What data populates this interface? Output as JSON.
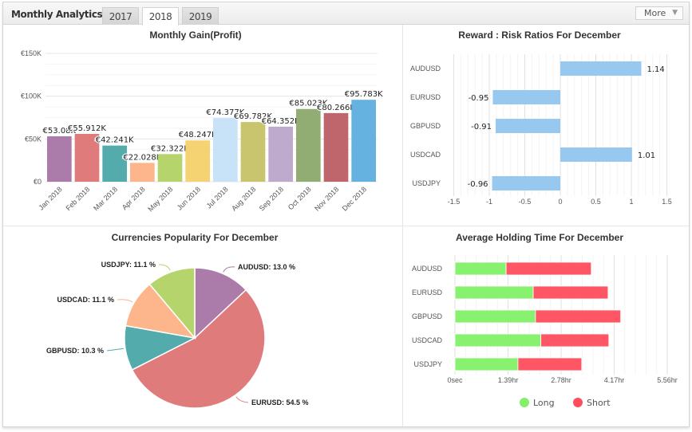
{
  "header": {
    "title": "Monthly Analytics",
    "tabs": [
      {
        "label": "2017",
        "active": false
      },
      {
        "label": "2018",
        "active": true
      },
      {
        "label": "2019",
        "active": false
      }
    ],
    "more_label": "More",
    "more_icon": "caret-down-icon"
  },
  "chart_data": [
    {
      "id": "monthly-gain",
      "type": "bar",
      "title": "Monthly Gain(Profit)",
      "xlabel": "",
      "ylabel": "",
      "categories": [
        "Jan 2018",
        "Feb 2018",
        "Mar 2018",
        "Apr 2018",
        "May 2018",
        "Jun 2018",
        "Jul 2018",
        "Aug 2018",
        "Sep 2018",
        "Oct 2018",
        "Nov 2018",
        "Dec 2018"
      ],
      "values": [
        53.08,
        55.912,
        42.241,
        22.028,
        32.322,
        48.247,
        74.377,
        69.782,
        64.352,
        85.023,
        80.266,
        95.783
      ],
      "data_labels": [
        "€53.08K",
        "€55.912K",
        "€42.241K",
        "€22.028K",
        "€32.322K",
        "€48.247K",
        "€74.377K",
        "€69.782K",
        "€64.352K",
        "€85.023K",
        "€80.266K",
        "€95.783K"
      ],
      "colors": [
        "#ab7ba9",
        "#e07b7b",
        "#54abab",
        "#fdb68c",
        "#b6d46c",
        "#f5d272",
        "#c8e2f7",
        "#c9c46e",
        "#bdaacd",
        "#92ad74",
        "#bf666d",
        "#65b1df"
      ],
      "ylim": [
        0,
        150
      ],
      "yticks": [
        0,
        50,
        100,
        150
      ],
      "ytick_labels": [
        "€0",
        "€50K",
        "€100K",
        "€150K"
      ],
      "unit": "K EUR",
      "grid": true,
      "legend": "none"
    },
    {
      "id": "reward-risk",
      "type": "bar",
      "orientation": "horizontal",
      "title": "Reward : Risk Ratios For December",
      "categories": [
        "AUDUSD",
        "EURUSD",
        "GBPUSD",
        "USDCAD",
        "USDJPY"
      ],
      "values": [
        1.14,
        -0.95,
        -0.91,
        1.01,
        -0.96
      ],
      "data_labels": [
        "1.14",
        "-0.95",
        "-0.91",
        "1.01",
        "-0.96"
      ],
      "color": "#97c8f0",
      "xlim": [
        -1.5,
        1.5
      ],
      "xticks": [
        -1.5,
        -1,
        -0.5,
        0,
        0.5,
        1,
        1.5
      ],
      "xtick_labels": [
        "-1.5",
        "-1",
        "-0.5",
        "0",
        "0.5",
        "1",
        "1.5"
      ],
      "grid": true,
      "legend": "none"
    },
    {
      "id": "currencies-popularity",
      "type": "pie",
      "title": "Currencies Popularity For December",
      "labels": [
        "AUDUSD",
        "EURUSD",
        "GBPUSD",
        "USDCAD",
        "USDJPY"
      ],
      "values": [
        13.0,
        54.5,
        10.3,
        11.1,
        11.1
      ],
      "data_labels": [
        "AUDUSD: 13.0 %",
        "EURUSD: 54.5 %",
        "GBPUSD: 10.3 %",
        "USDCAD: 11.1 %",
        "USDJPY: 11.1 %"
      ],
      "colors": [
        "#ab7ba9",
        "#e07b7b",
        "#54abab",
        "#fdb68c",
        "#b6d46c"
      ],
      "legend": "none"
    },
    {
      "id": "holding-time",
      "type": "bar",
      "orientation": "horizontal",
      "stacked": true,
      "title": "Average Holding Time For December",
      "categories": [
        "AUDUSD",
        "EURUSD",
        "GBPUSD",
        "USDCAD",
        "USDJPY"
      ],
      "series": [
        {
          "name": "Long",
          "color": "#82f068",
          "values": [
            1.34,
            2.05,
            2.11,
            2.25,
            1.65
          ]
        },
        {
          "name": "Short",
          "color": "#ff4d5e",
          "values": [
            2.23,
            1.96,
            2.23,
            1.78,
            1.67
          ]
        }
      ],
      "unit": "hr",
      "xlim": [
        0,
        5.56
      ],
      "xticks": [
        0,
        1.39,
        2.78,
        4.17,
        5.56
      ],
      "xtick_labels": [
        "0sec",
        "1.39hr",
        "2.78hr",
        "4.17hr",
        "5.56hr"
      ],
      "grid": true,
      "legend": "bottom-center"
    }
  ]
}
